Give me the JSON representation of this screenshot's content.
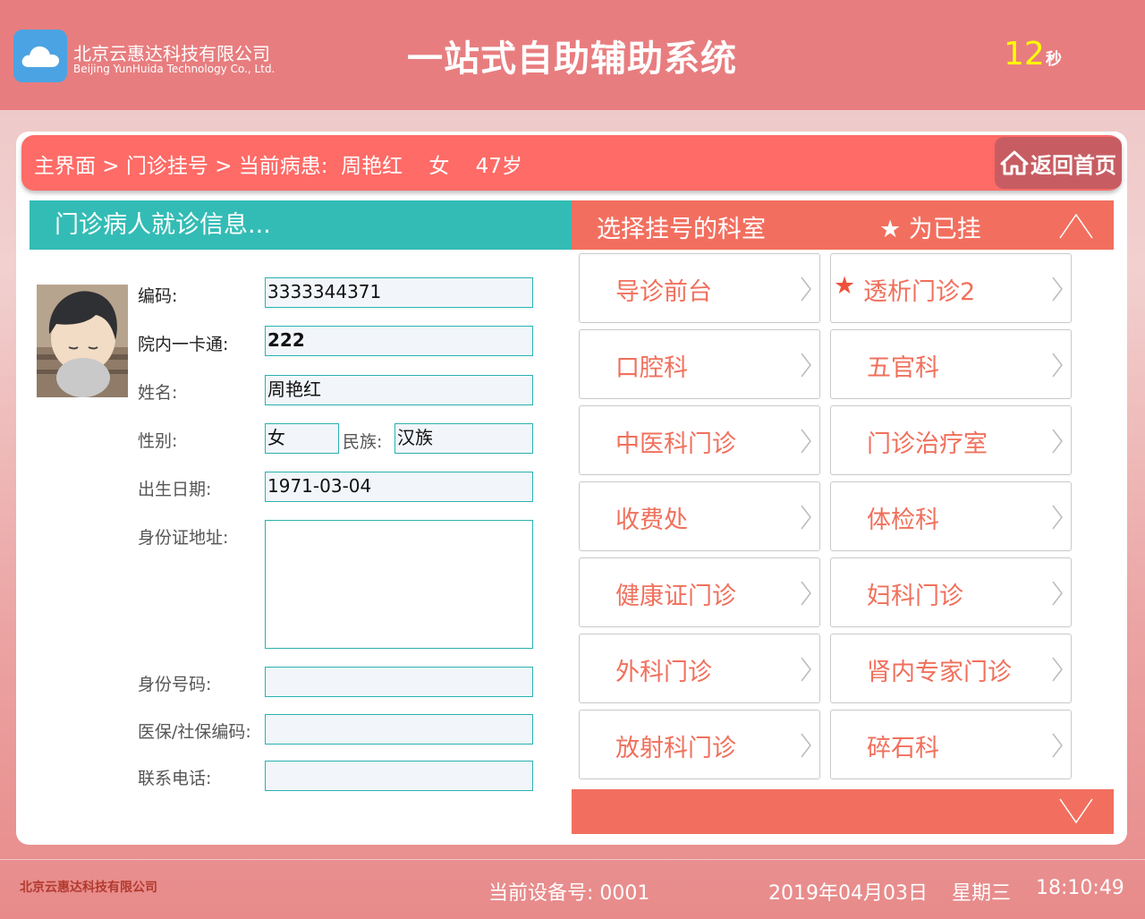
{
  "header": {
    "company_cn": "北京云惠达科技有限公司",
    "company_en": "Beijing YunHuida Technology Co., Ltd.",
    "title": "一站式自助辅助系统",
    "countdown": "12",
    "countdown_unit": "秒",
    "logo_icon": "cloud-icon",
    "logo_color": "#4ba3e3"
  },
  "breadcrumb": {
    "text": "主界面 > 门诊挂号 > 当前病患:  周艳红    女    47岁",
    "home_label": "返回首页",
    "home_icon": "home-icon"
  },
  "patient": {
    "section_title": "门诊病人就诊信息...",
    "labels": {
      "code": "编码:",
      "card": "院内一卡通:",
      "name": "姓名:",
      "gender": "性别:",
      "ethnicity": "民族:",
      "birth": "出生日期:",
      "address": "身份证地址:",
      "id_number": "身份号码:",
      "insurance": "医保/社保编码:",
      "phone": "联系电话:"
    },
    "values": {
      "code": "3333344371",
      "card": "222",
      "name": "周艳红",
      "gender": "女",
      "ethnicity": "汉族",
      "birth": "1971-03-04",
      "address": "",
      "id_number": "",
      "insurance": "",
      "phone": ""
    }
  },
  "departments": {
    "title": "选择挂号的科室",
    "legend": "★ 为已挂",
    "items": [
      {
        "name": "导诊前台",
        "registered": false
      },
      {
        "name": "透析门诊2",
        "registered": true
      },
      {
        "name": "口腔科",
        "registered": false
      },
      {
        "name": "五官科",
        "registered": false
      },
      {
        "name": "中医科门诊",
        "registered": false
      },
      {
        "name": "门诊治疗室",
        "registered": false
      },
      {
        "name": "收费处",
        "registered": false
      },
      {
        "name": "体检科",
        "registered": false
      },
      {
        "name": "健康证门诊",
        "registered": false
      },
      {
        "name": "妇科门诊",
        "registered": false
      },
      {
        "name": "外科门诊",
        "registered": false
      },
      {
        "name": "肾内专家门诊",
        "registered": false
      },
      {
        "name": "放射科门诊",
        "registered": false
      },
      {
        "name": "碎石科",
        "registered": false
      }
    ],
    "star_symbol": "★"
  },
  "footer": {
    "company": "北京云惠达科技有限公司",
    "device": "当前设备号: 0001",
    "date": "2019年04月03日",
    "weekday": "星期三",
    "time": "18:10:49"
  },
  "colors": {
    "header_bg": "#e87d7f",
    "crumb_bg": "#ff6b67",
    "teal": "#33bcb5",
    "dept_head": "#f26f5f",
    "dept_text": "#f0705c"
  }
}
